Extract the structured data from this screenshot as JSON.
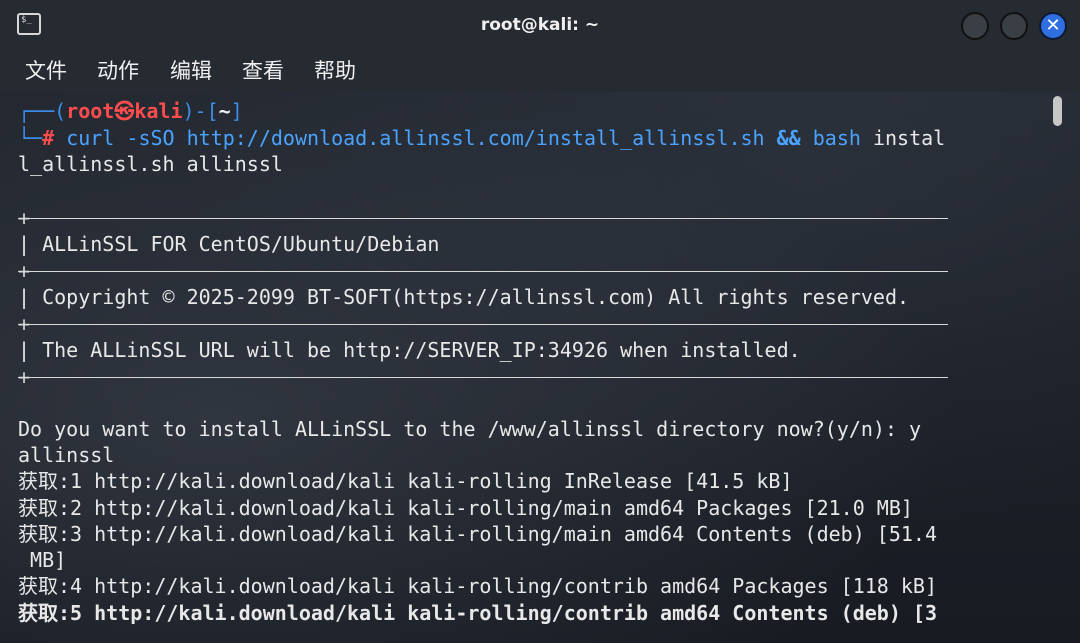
{
  "window": {
    "title": "root@kali: ~",
    "icon": "terminal-icon",
    "close_glyph": "✕"
  },
  "menu": [
    "文件",
    "动作",
    "编辑",
    "查看",
    "帮助"
  ],
  "prompt": {
    "open": "┌──(",
    "user": "root",
    "at": "㉿",
    "host": "kali",
    "mid": ")-[",
    "dir": "~",
    "close": "]",
    "second": "└─",
    "hash": "#"
  },
  "command": {
    "cmd": "curl",
    "args": " -sSO http://download.allinssl.com/install_allinssl.sh ",
    "op": "&&",
    "cmd2": " bash",
    "rest1": " instal",
    "rest2": "l_allinssl.sh allinssl"
  },
  "banner": {
    "plus": "+",
    "line1": "| ALLinSSL FOR CentOS/Ubuntu/Debian",
    "line2": "| Copyright © 2025-2099 BT-SOFT(https://allinssl.com) All rights reserved.",
    "line3": "| The ALLinSSL URL will be http://SERVER_IP:34926 when installed."
  },
  "output": {
    "question": "Do you want to install ALLinSSL to the /www/allinssl directory now?(y/n): y",
    "name": "allinssl",
    "get1": "获取:1 http://kali.download/kali kali-rolling InRelease [41.5 kB]",
    "get2": "获取:2 http://kali.download/kali kali-rolling/main amd64 Packages [21.0 MB]",
    "get3a": "获取:3 http://kali.download/kali kali-rolling/main amd64 Contents (deb) [51.4",
    "get3b": " MB]",
    "get4": "获取:4 http://kali.download/kali kali-rolling/contrib amd64 Packages [118 kB]",
    "get5": "获取:5 http://kali.download/kali kali-rolling/contrib amd64 Contents (deb) [3"
  },
  "colors": {
    "prompt_frame": "#3b8eea",
    "prompt_user": "#ff4d4d",
    "command": "#4aa3ff",
    "close_button": "#2f6fe0"
  }
}
